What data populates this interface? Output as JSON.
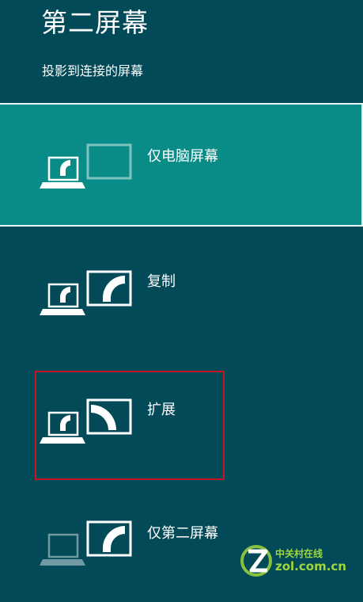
{
  "window": {
    "title": "第二屏幕",
    "subtitle": "投影到连接的屏幕"
  },
  "options": [
    {
      "label": "仅电脑屏幕",
      "selected": true
    },
    {
      "label": "复制",
      "selected": false
    },
    {
      "label": "扩展",
      "selected": false,
      "highlighted": true
    },
    {
      "label": "仅第二屏幕",
      "selected": false
    }
  ],
  "watermark": {
    "cn": "中关村在线",
    "en": "zol.com.cn"
  },
  "colors": {
    "background": "#034a58",
    "selected": "#098b87",
    "highlight_border": "#c5141d",
    "watermark": "#9fd63a"
  }
}
